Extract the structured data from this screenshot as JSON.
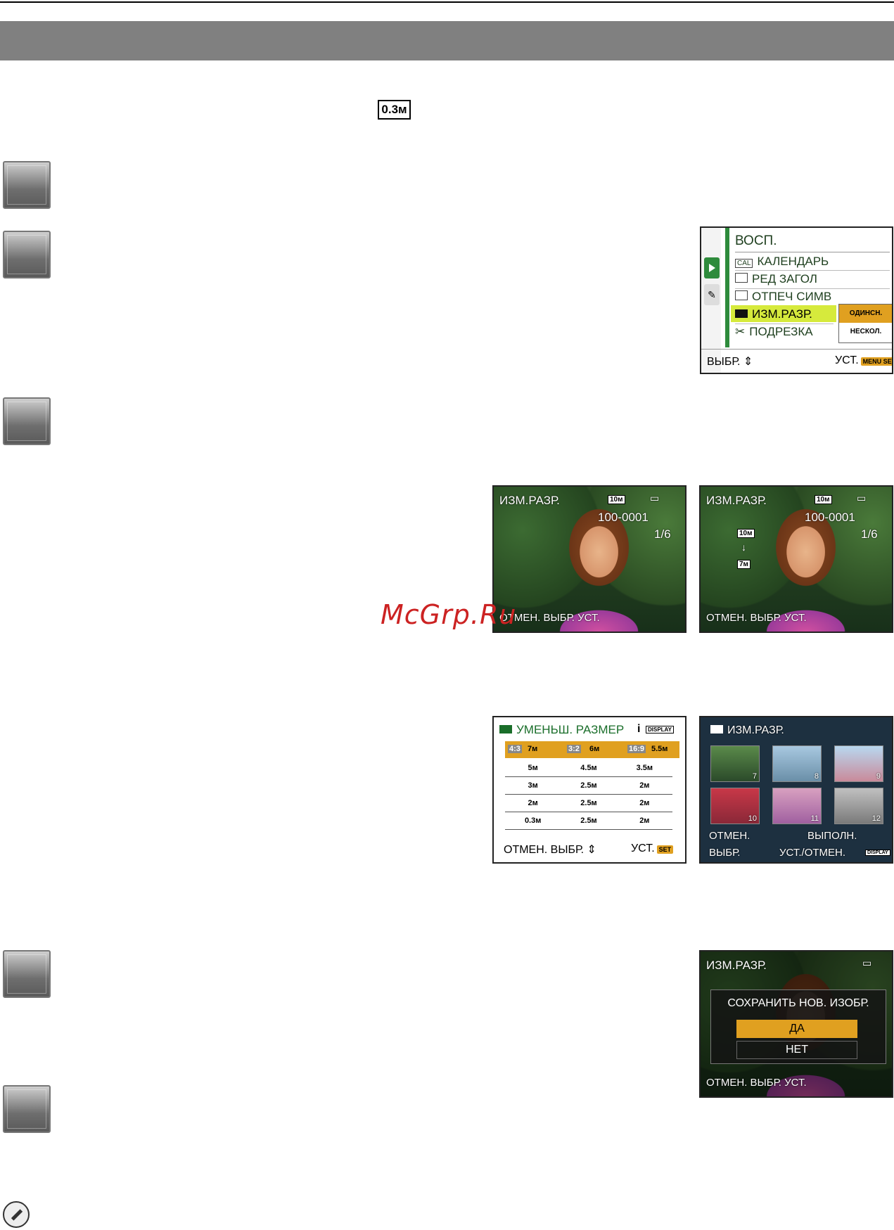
{
  "header": {
    "badge": "0.3м"
  },
  "watermark": "McGrp.Ru",
  "menu_screen": {
    "title": "ВОСП.",
    "items": [
      "КАЛЕНДАРЬ",
      "РЕД ЗАГОЛ",
      "ОТПЕЧ СИМВ",
      "ИЗМ.РАЗР.",
      "ПОДРЕЗКА"
    ],
    "cal_tag": "CAL",
    "submenu": [
      "ОДИНСН.",
      "НЕСКОЛ."
    ],
    "footer_left": "ВЫБР.",
    "footer_right": "УСТ.",
    "menu_set": "MENU SET"
  },
  "single_screen_a": {
    "title": "ИЗМ.РАЗР.",
    "size": "10м",
    "file": "100-0001",
    "count": "1/6",
    "footer": "ОТМЕН. ВЫБР. УСТ."
  },
  "single_screen_b": {
    "title": "ИЗМ.РАЗР.",
    "size": "10м",
    "file": "100-0001",
    "count": "1/6",
    "from_size": "10м",
    "to_size": "7м",
    "footer": "ОТМЕН. ВЫБР. УСТ."
  },
  "reduce_screen": {
    "title": "УМЕНЬШ. РАЗМЕР",
    "display": "DISPLAY",
    "header_row": [
      "4:3",
      "7м",
      "3:2",
      "6м",
      "16:9",
      "5.5м"
    ],
    "rows": [
      [
        "5м",
        "4.5м",
        "3.5м"
      ],
      [
        "3м",
        "2.5м",
        "2м"
      ],
      [
        "2м",
        "2.5м",
        "2м"
      ],
      [
        "0.3м",
        "2.5м",
        "2м"
      ]
    ],
    "footer": "ОТМЕН. ВЫБР.",
    "footer_right": "УСТ."
  },
  "multi_screen": {
    "title": "ИЗМ.РАЗР.",
    "thumb_numbers": [
      "7",
      "8",
      "9",
      "10",
      "11",
      "12"
    ],
    "cancel": "ОТМЕН.",
    "execute": "ВЫПОЛН.",
    "select": "ВЫБР.",
    "set_cancel": "УСТ./ОТМЕН.",
    "display": "DISPLAY"
  },
  "confirm_screen": {
    "title": "ИЗМ.РАЗР.",
    "question": "СОХРАНИТЬ НОВ. ИЗОБР.",
    "yes": "ДА",
    "no": "НЕТ",
    "footer": "ОТМЕН. ВЫБР. УСТ."
  },
  "colors": {
    "band": "#808080",
    "menu_highlight": "#d6ea3c",
    "accent_orange": "#e0a020"
  }
}
